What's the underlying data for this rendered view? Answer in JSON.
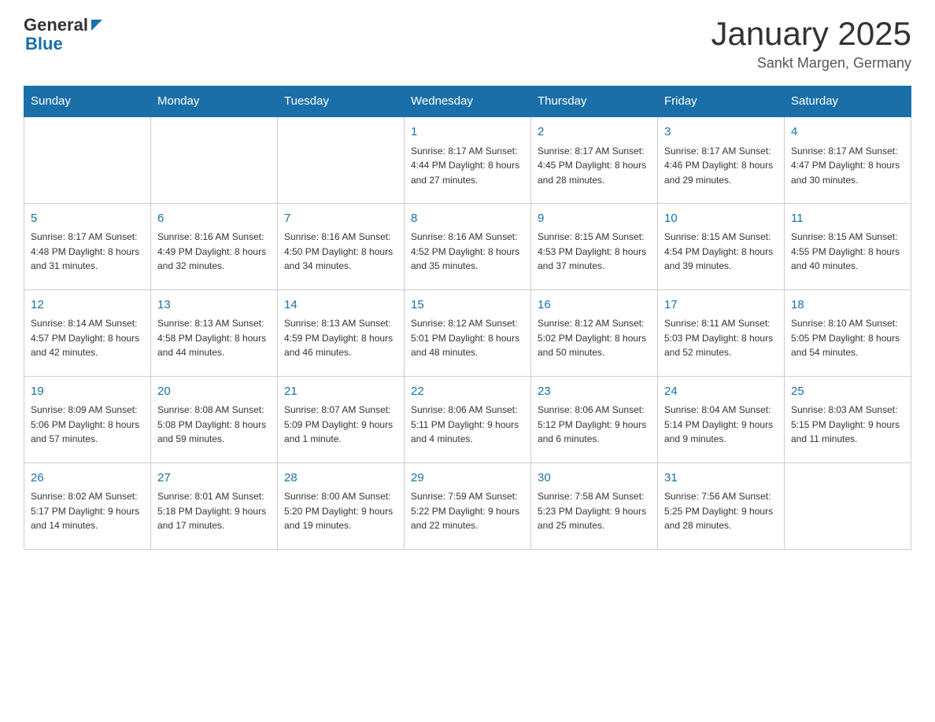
{
  "header": {
    "logo": {
      "general": "General",
      "blue": "Blue"
    },
    "title": "January 2025",
    "subtitle": "Sankt Margen, Germany"
  },
  "days_of_week": [
    "Sunday",
    "Monday",
    "Tuesday",
    "Wednesday",
    "Thursday",
    "Friday",
    "Saturday"
  ],
  "weeks": [
    [
      {
        "day": "",
        "info": ""
      },
      {
        "day": "",
        "info": ""
      },
      {
        "day": "",
        "info": ""
      },
      {
        "day": "1",
        "info": "Sunrise: 8:17 AM\nSunset: 4:44 PM\nDaylight: 8 hours\nand 27 minutes."
      },
      {
        "day": "2",
        "info": "Sunrise: 8:17 AM\nSunset: 4:45 PM\nDaylight: 8 hours\nand 28 minutes."
      },
      {
        "day": "3",
        "info": "Sunrise: 8:17 AM\nSunset: 4:46 PM\nDaylight: 8 hours\nand 29 minutes."
      },
      {
        "day": "4",
        "info": "Sunrise: 8:17 AM\nSunset: 4:47 PM\nDaylight: 8 hours\nand 30 minutes."
      }
    ],
    [
      {
        "day": "5",
        "info": "Sunrise: 8:17 AM\nSunset: 4:48 PM\nDaylight: 8 hours\nand 31 minutes."
      },
      {
        "day": "6",
        "info": "Sunrise: 8:16 AM\nSunset: 4:49 PM\nDaylight: 8 hours\nand 32 minutes."
      },
      {
        "day": "7",
        "info": "Sunrise: 8:16 AM\nSunset: 4:50 PM\nDaylight: 8 hours\nand 34 minutes."
      },
      {
        "day": "8",
        "info": "Sunrise: 8:16 AM\nSunset: 4:52 PM\nDaylight: 8 hours\nand 35 minutes."
      },
      {
        "day": "9",
        "info": "Sunrise: 8:15 AM\nSunset: 4:53 PM\nDaylight: 8 hours\nand 37 minutes."
      },
      {
        "day": "10",
        "info": "Sunrise: 8:15 AM\nSunset: 4:54 PM\nDaylight: 8 hours\nand 39 minutes."
      },
      {
        "day": "11",
        "info": "Sunrise: 8:15 AM\nSunset: 4:55 PM\nDaylight: 8 hours\nand 40 minutes."
      }
    ],
    [
      {
        "day": "12",
        "info": "Sunrise: 8:14 AM\nSunset: 4:57 PM\nDaylight: 8 hours\nand 42 minutes."
      },
      {
        "day": "13",
        "info": "Sunrise: 8:13 AM\nSunset: 4:58 PM\nDaylight: 8 hours\nand 44 minutes."
      },
      {
        "day": "14",
        "info": "Sunrise: 8:13 AM\nSunset: 4:59 PM\nDaylight: 8 hours\nand 46 minutes."
      },
      {
        "day": "15",
        "info": "Sunrise: 8:12 AM\nSunset: 5:01 PM\nDaylight: 8 hours\nand 48 minutes."
      },
      {
        "day": "16",
        "info": "Sunrise: 8:12 AM\nSunset: 5:02 PM\nDaylight: 8 hours\nand 50 minutes."
      },
      {
        "day": "17",
        "info": "Sunrise: 8:11 AM\nSunset: 5:03 PM\nDaylight: 8 hours\nand 52 minutes."
      },
      {
        "day": "18",
        "info": "Sunrise: 8:10 AM\nSunset: 5:05 PM\nDaylight: 8 hours\nand 54 minutes."
      }
    ],
    [
      {
        "day": "19",
        "info": "Sunrise: 8:09 AM\nSunset: 5:06 PM\nDaylight: 8 hours\nand 57 minutes."
      },
      {
        "day": "20",
        "info": "Sunrise: 8:08 AM\nSunset: 5:08 PM\nDaylight: 8 hours\nand 59 minutes."
      },
      {
        "day": "21",
        "info": "Sunrise: 8:07 AM\nSunset: 5:09 PM\nDaylight: 9 hours\nand 1 minute."
      },
      {
        "day": "22",
        "info": "Sunrise: 8:06 AM\nSunset: 5:11 PM\nDaylight: 9 hours\nand 4 minutes."
      },
      {
        "day": "23",
        "info": "Sunrise: 8:06 AM\nSunset: 5:12 PM\nDaylight: 9 hours\nand 6 minutes."
      },
      {
        "day": "24",
        "info": "Sunrise: 8:04 AM\nSunset: 5:14 PM\nDaylight: 9 hours\nand 9 minutes."
      },
      {
        "day": "25",
        "info": "Sunrise: 8:03 AM\nSunset: 5:15 PM\nDaylight: 9 hours\nand 11 minutes."
      }
    ],
    [
      {
        "day": "26",
        "info": "Sunrise: 8:02 AM\nSunset: 5:17 PM\nDaylight: 9 hours\nand 14 minutes."
      },
      {
        "day": "27",
        "info": "Sunrise: 8:01 AM\nSunset: 5:18 PM\nDaylight: 9 hours\nand 17 minutes."
      },
      {
        "day": "28",
        "info": "Sunrise: 8:00 AM\nSunset: 5:20 PM\nDaylight: 9 hours\nand 19 minutes."
      },
      {
        "day": "29",
        "info": "Sunrise: 7:59 AM\nSunset: 5:22 PM\nDaylight: 9 hours\nand 22 minutes."
      },
      {
        "day": "30",
        "info": "Sunrise: 7:58 AM\nSunset: 5:23 PM\nDaylight: 9 hours\nand 25 minutes."
      },
      {
        "day": "31",
        "info": "Sunrise: 7:56 AM\nSunset: 5:25 PM\nDaylight: 9 hours\nand 28 minutes."
      },
      {
        "day": "",
        "info": ""
      }
    ]
  ]
}
